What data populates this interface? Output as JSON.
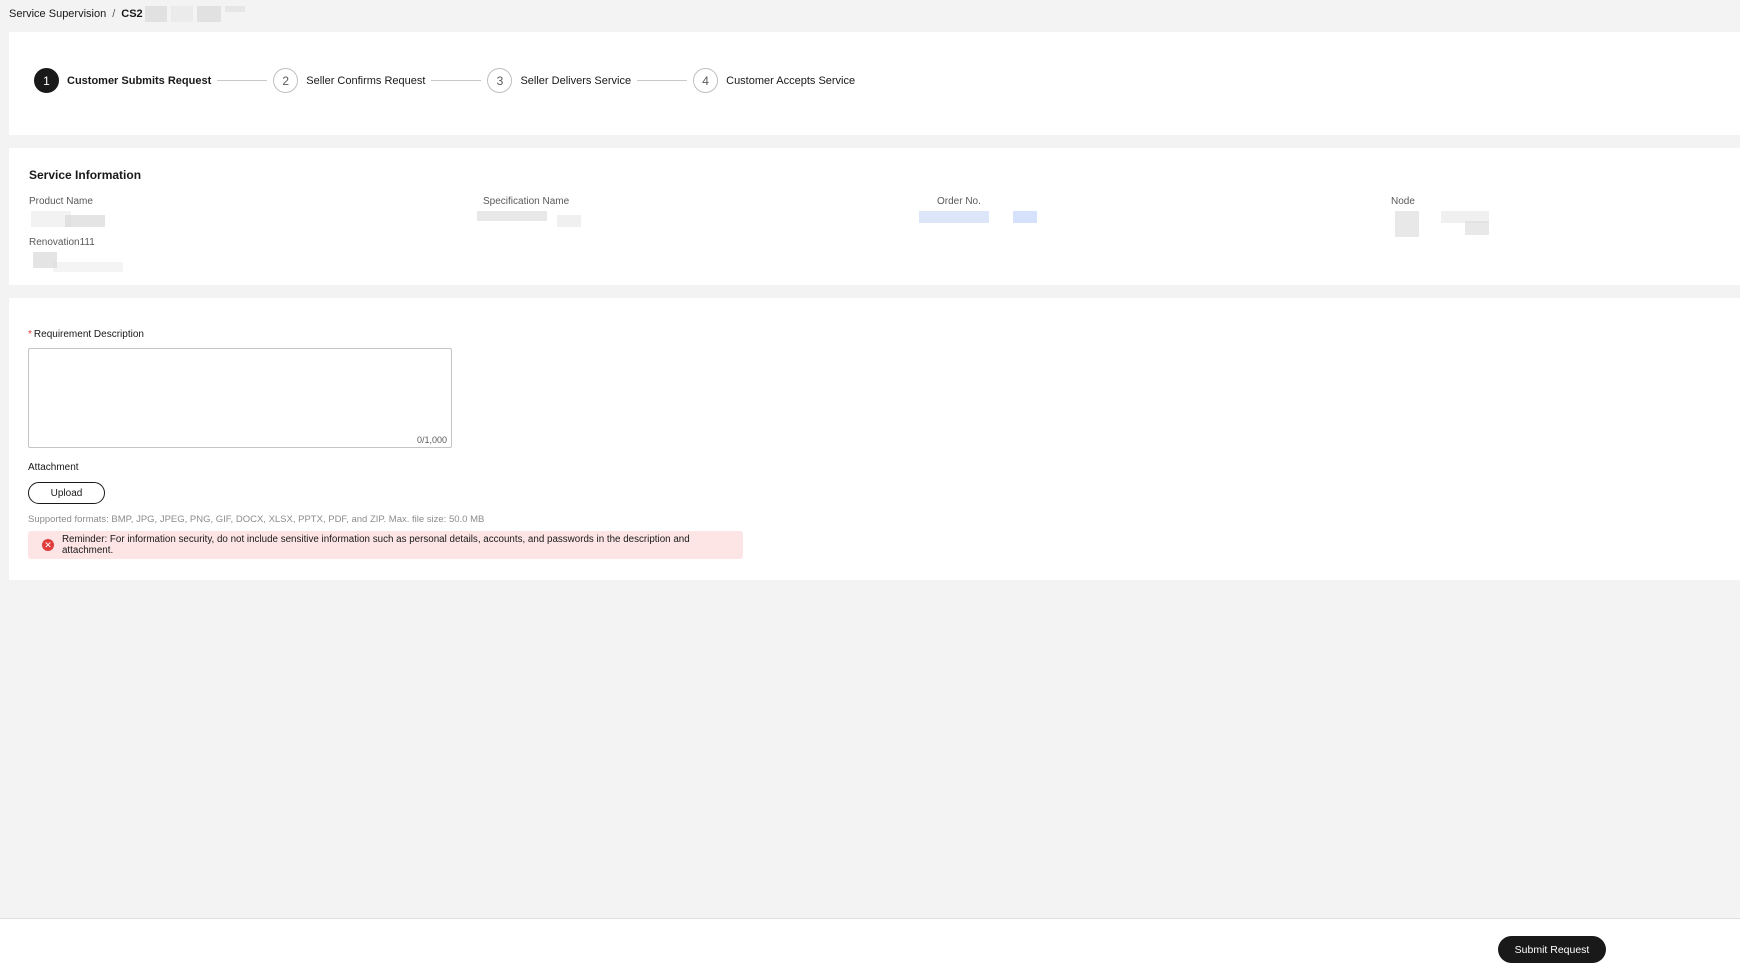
{
  "breadcrumb": {
    "parent": "Service Supervision",
    "separator": "/",
    "current": "CS2"
  },
  "steps": [
    {
      "number": "1",
      "label": "Customer Submits Request",
      "active": true
    },
    {
      "number": "2",
      "label": "Seller Confirms Request",
      "active": false
    },
    {
      "number": "3",
      "label": "Seller Delivers Service",
      "active": false
    },
    {
      "number": "4",
      "label": "Customer Accepts Service",
      "active": false
    }
  ],
  "service_info": {
    "title": "Service Information",
    "fields": {
      "product_name": "Product Name",
      "specification_name": "Specification Name",
      "order_no": "Order No.",
      "node": "Node",
      "renovation": "Renovation111"
    }
  },
  "form": {
    "requirement_label": "Requirement Description",
    "required_mark": "*",
    "requirement_value": "",
    "char_count": "0/1,000",
    "attachment_label": "Attachment",
    "upload_label": "Upload",
    "formats_text": "Supported formats: BMP, JPG, JPEG, PNG, GIF, DOCX, XLSX, PPTX, PDF, and ZIP. Max. file size: 50.0 MB",
    "reminder_icon": "error-icon",
    "reminder_text": "Reminder: For information security, do not include sensitive information such as personal details, accounts, and passwords in the description and attachment."
  },
  "footer": {
    "submit_label": "Submit Request"
  },
  "colors": {
    "primary": "#191919",
    "background": "#f3f3f3",
    "alert_bg": "#fde5e5",
    "alert_icon": "#e03c3c"
  }
}
